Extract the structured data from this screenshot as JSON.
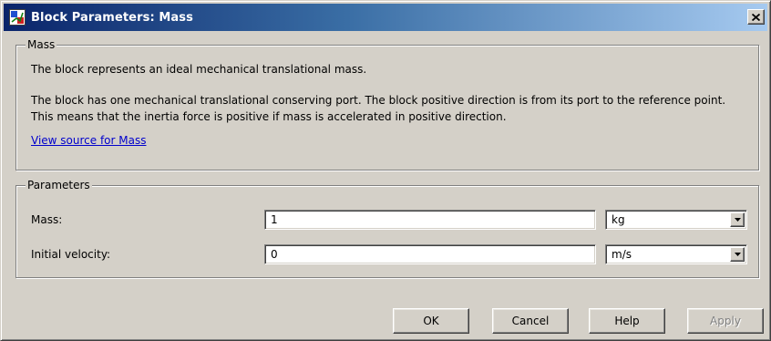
{
  "window": {
    "title": "Block Parameters: Mass",
    "icon": "simulink-block-icon",
    "close_icon": "close-icon"
  },
  "description": {
    "legend": "Mass",
    "line1": "The block represents an ideal mechanical translational mass.",
    "line2": "The block has one mechanical translational conserving port. The block positive direction is from its port to the reference point.",
    "line3": "This means that the inertia force is positive if mass is accelerated in positive direction.",
    "link": "View source for Mass"
  },
  "parameters": {
    "legend": "Parameters",
    "rows": [
      {
        "label": "Mass:",
        "value": "1",
        "unit": "kg"
      },
      {
        "label": "Initial velocity:",
        "value": "0",
        "unit": "m/s"
      }
    ]
  },
  "buttons": {
    "ok": "OK",
    "cancel": "Cancel",
    "help": "Help",
    "apply": "Apply",
    "apply_enabled": false
  },
  "colors": {
    "titlebar_start": "#0a246a",
    "titlebar_end": "#a6caf0",
    "dialog_bg": "#d4d0c8",
    "link": "#0000cc"
  }
}
